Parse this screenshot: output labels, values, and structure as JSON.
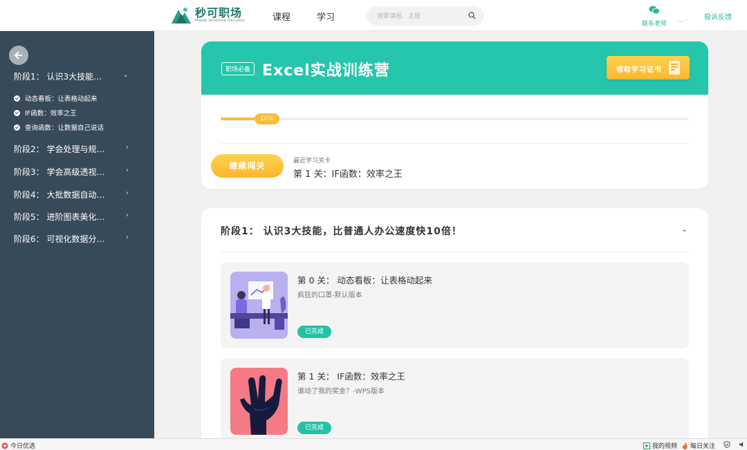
{
  "header": {
    "logo_cn": "秒可职场",
    "logo_en": "Miaoke Vocational Education",
    "nav": [
      "课程",
      "学习"
    ],
    "search_placeholder": "搜索课程、主题",
    "contact_label": "联系老师",
    "feedback_label": "投诉反馈"
  },
  "sidebar": {
    "stages": [
      {
        "label": "阶段1： 认识3大技能…",
        "expanded": true
      },
      {
        "label": "阶段2： 学会处理与规…",
        "expanded": false
      },
      {
        "label": "阶段3： 学会高级透视…",
        "expanded": false
      },
      {
        "label": "阶段4： 大批数据自动…",
        "expanded": false
      },
      {
        "label": "阶段5： 进阶图表美化…",
        "expanded": false
      },
      {
        "label": "阶段6： 可视化数据分…",
        "expanded": false
      }
    ],
    "sub_items": [
      "动态看板：让表格动起来",
      "IF函数：效率之王",
      "查询函数：让数据自己说话"
    ]
  },
  "course": {
    "tag": "职场必备",
    "title": "Excel实战训练营",
    "cert_label": "领取学习证书",
    "progress_percent": 10,
    "progress_label": "10%",
    "continue_label": "继续闯关",
    "recent_label": "最近学习关卡",
    "recent_level": "第 1 关：IF函数：效率之王"
  },
  "stage_section": {
    "title": "阶段1： 认识3大技能，比普通人办公速度快10倍！",
    "levels": [
      {
        "title": "第 0 关： 动态看板：让表格动起来",
        "subtitle": "疯狂的口罩-默认版本",
        "status": "已完成"
      },
      {
        "title": "第 1 关： IF函数：效率之王",
        "subtitle": "谁动了我的奖金？-WPS版本",
        "status": "已完成"
      }
    ]
  },
  "statusbar": {
    "left": "今日优选",
    "video": "我的视频",
    "daily": "每日关注"
  },
  "colors": {
    "accent": "#25c6ac",
    "sidebar": "#374a5a",
    "gold": "#fcbc33"
  }
}
